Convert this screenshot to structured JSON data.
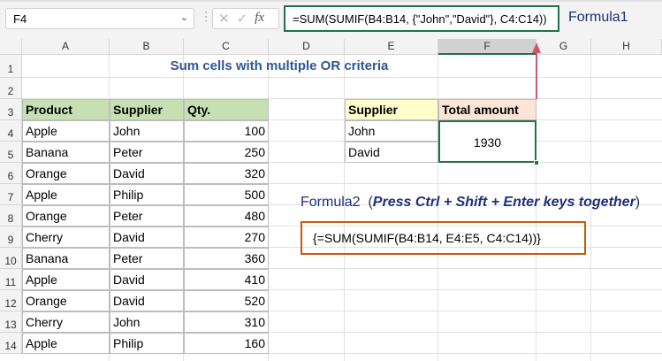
{
  "name_box": "F4",
  "formula_bar": "=SUM(SUMIF(B4:B14, {\"John\",\"David\"}, C4:C14))",
  "formula1_label": "Formula1",
  "columns": [
    "A",
    "B",
    "C",
    "D",
    "E",
    "F",
    "G",
    "H"
  ],
  "rows": [
    "1",
    "2",
    "3",
    "4",
    "5",
    "6",
    "7",
    "8",
    "9",
    "10",
    "11",
    "12",
    "13",
    "14"
  ],
  "title": "Sum cells with multiple OR criteria",
  "table": {
    "headers": [
      "Product",
      "Supplier",
      "Qty."
    ],
    "rows": [
      [
        "Apple",
        "John",
        "100"
      ],
      [
        "Banana",
        "Peter",
        "250"
      ],
      [
        "Orange",
        "David",
        "320"
      ],
      [
        "Apple",
        "Philip",
        "500"
      ],
      [
        "Orange",
        "Peter",
        "480"
      ],
      [
        "Cherry",
        "David",
        "270"
      ],
      [
        "Banana",
        "Peter",
        "360"
      ],
      [
        "Apple",
        "David",
        "410"
      ],
      [
        "Orange",
        "David",
        "520"
      ],
      [
        "Cherry",
        "John",
        "310"
      ],
      [
        "Apple",
        "Philip",
        "160"
      ]
    ]
  },
  "criteria": {
    "header_supplier": "Supplier",
    "header_total": "Total amount",
    "suppliers": [
      "John",
      "David"
    ],
    "total": "1930"
  },
  "formula2": {
    "label": "Formula2",
    "note_open": "(",
    "note": "Press Ctrl + Shift + Enter keys together",
    "note_close": ")",
    "formula": "{=SUM(SUMIF(B4:B14, E4:E5, C4:C14))}"
  }
}
